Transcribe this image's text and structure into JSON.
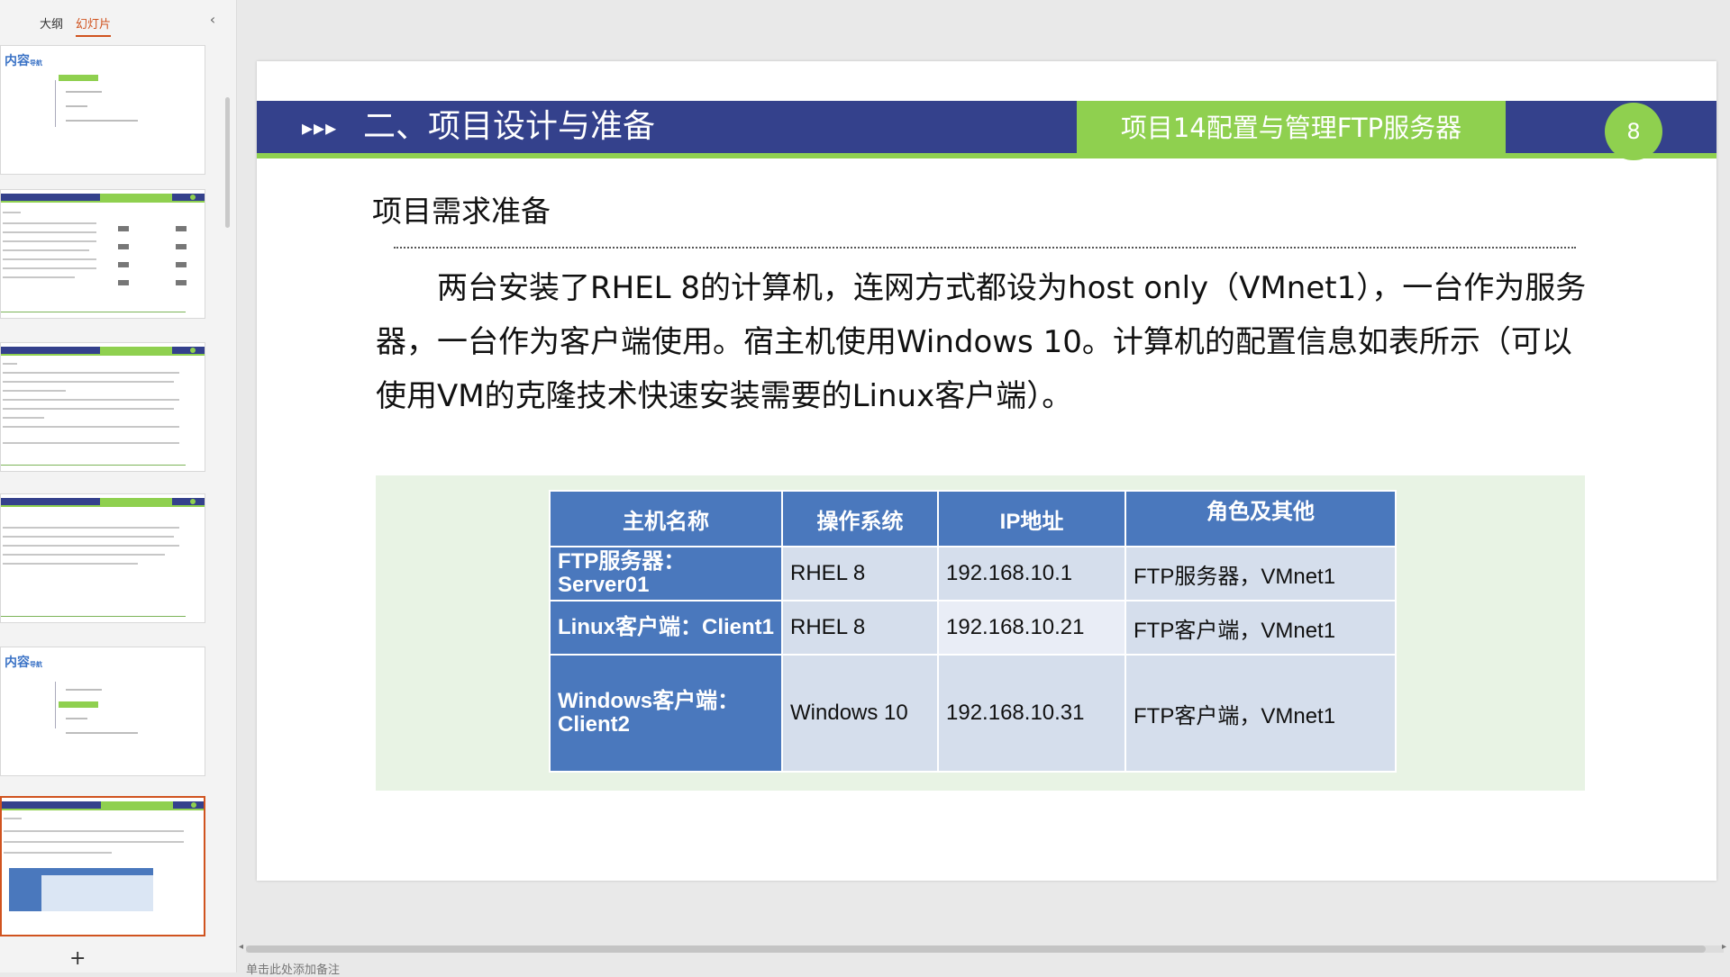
{
  "sidebar": {
    "tabs": [
      {
        "label": "大纲"
      },
      {
        "label": "幻灯片"
      }
    ],
    "collapse_icon": "chevron-left-icon",
    "add_icon": "plus-icon",
    "thumb_content_title": "内容",
    "thumb_content_sub": "导航"
  },
  "slide": {
    "header_arrows": "▸▸▸",
    "header_title": "二、项目设计与准备",
    "header_subtitle": "项目14配置与管理FTP服务器",
    "page_number": "8",
    "section_title": "项目需求准备",
    "body_text": "两台安装了RHEL 8的计算机，连网方式都设为host only（VMnet1），一台作为服务器，一台作为客户端使用。宿主机使用Windows 10。计算机的配置信息如表所示（可以使用VM的克隆技术快速安装需要的Linux客户端）。",
    "table": {
      "headers": [
        "主机名称",
        "操作系统",
        "IP地址",
        "角色及其他"
      ],
      "rows": [
        {
          "host": "FTP服务器：Server01",
          "os": "RHEL 8",
          "ip": "192.168.10.1",
          "role": "FTP服务器，VMnet1"
        },
        {
          "host": "Linux客户端：Client1",
          "os": "RHEL 8",
          "ip": "192.168.10.21",
          "role": "FTP客户端，VMnet1"
        },
        {
          "host": "Windows客户端：Client2",
          "os": "Windows 10",
          "ip": "192.168.10.31",
          "role": "FTP客户端，VMnet1"
        }
      ]
    }
  },
  "notes": {
    "placeholder": "单击此处添加备注"
  },
  "colors": {
    "header_blue": "#34418c",
    "accent_green": "#8fd04f",
    "table_blue": "#4a78bd",
    "selection_orange": "#d0531f"
  }
}
